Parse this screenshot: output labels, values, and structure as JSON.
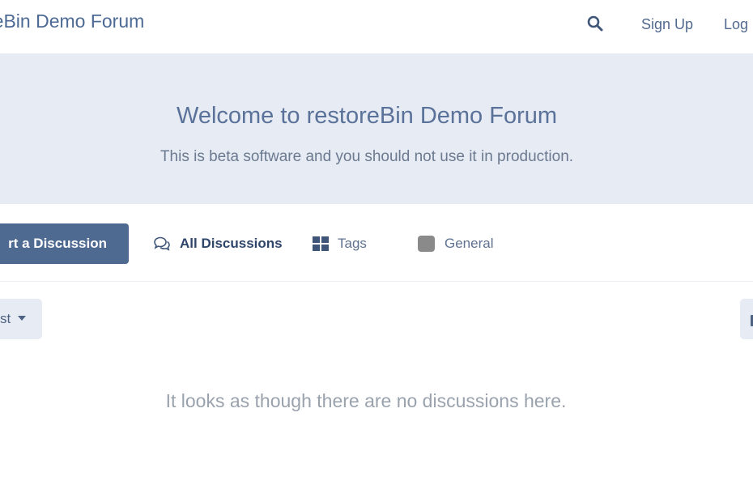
{
  "header": {
    "site_title": "reBin Demo Forum",
    "signup_label": "Sign Up",
    "login_label": "Log"
  },
  "hero": {
    "title": "Welcome to restoreBin Demo Forum",
    "text": "This is beta software and you should not use it in production."
  },
  "toolbar": {
    "start_discussion_label": "rt a Discussion",
    "nav": [
      {
        "label": "All Discussions",
        "icon": "chat-bubbles-icon"
      },
      {
        "label": "Tags",
        "icon": "grid-icon"
      },
      {
        "label": "General",
        "icon": "tag-square-icon"
      }
    ],
    "sort_label": "st"
  },
  "main": {
    "empty_message": "It looks as though there are no discussions here."
  },
  "colors": {
    "primary": "#4f6a91",
    "hero_bg": "#e7ebf3",
    "tag_general": "#8a8a8a"
  }
}
